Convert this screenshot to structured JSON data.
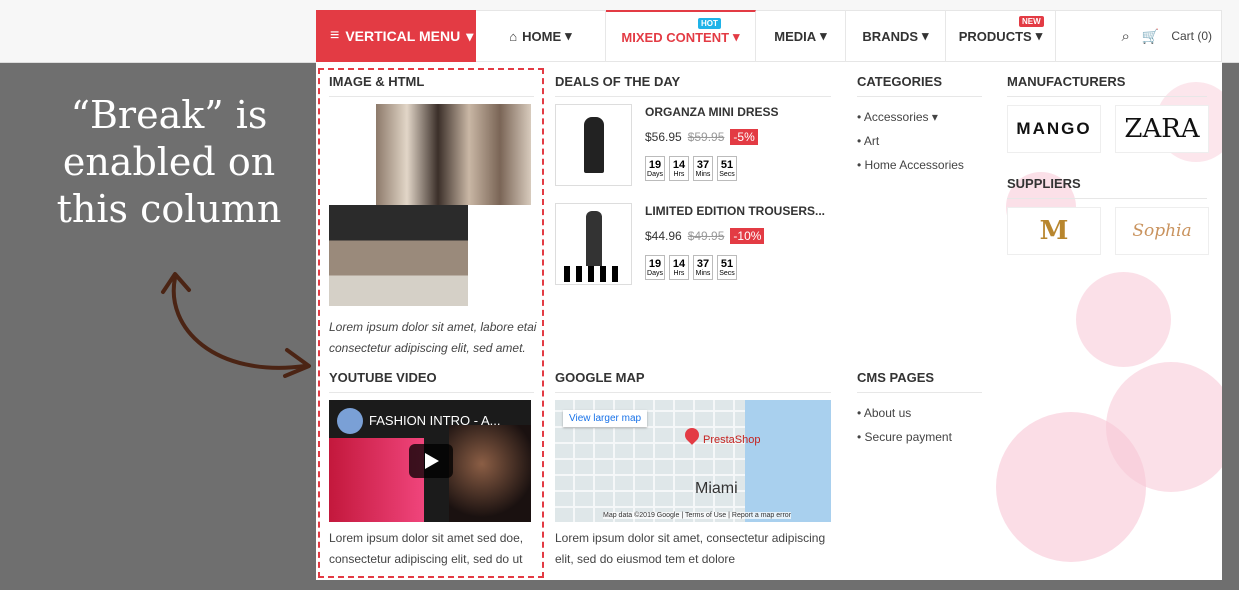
{
  "menu": {
    "vertical_menu": "VERTICAL MENU",
    "nav": [
      {
        "label": "HOME"
      },
      {
        "label": "MIXED CONTENT",
        "badge": "HOT",
        "badge_color": "#1fb3e8"
      },
      {
        "label": "MEDIA"
      },
      {
        "label": "BRANDS"
      },
      {
        "label": "PRODUCTS",
        "badge": "NEW",
        "badge_color": "#e33b44"
      }
    ],
    "cart_label": "Cart (0)"
  },
  "columns": {
    "image_html": {
      "title": "IMAGE & HTML",
      "text_line1": "Lorem ipsum dolor sit amet, labore etai",
      "text_line2": "consectetur adipiscing elit, sed amet."
    },
    "youtube": {
      "title": "YOUTUBE VIDEO",
      "video_title": "FASHION INTRO - A...",
      "text_line1": "Lorem ipsum dolor sit amet sed doe,",
      "text_line2": "consectetur adipiscing elit, sed do ut"
    },
    "deals": {
      "title": "DEALS OF THE DAY",
      "products": [
        {
          "name": "ORGANZA MINI DRESS",
          "price": "$56.95",
          "old_price": "$59.95",
          "discount": "-5%"
        },
        {
          "name": "LIMITED EDITION TROUSERS...",
          "price": "$44.96",
          "old_price": "$49.95",
          "discount": "-10%"
        }
      ],
      "timer": [
        {
          "value": "19",
          "unit": "Days"
        },
        {
          "value": "14",
          "unit": "Hrs"
        },
        {
          "value": "37",
          "unit": "Mins"
        },
        {
          "value": "51",
          "unit": "Secs"
        }
      ]
    },
    "google_map": {
      "title": "GOOGLE MAP",
      "larger_map": "View larger map",
      "place": "PrestaShop",
      "city": "Miami",
      "attribution": "Map data ©2019 Google | Terms of Use | Report a map error",
      "text_line1": "Lorem ipsum dolor sit amet, consectetur adipiscing",
      "text_line2": "elit, sed do eiusmod tem et dolore"
    },
    "categories": {
      "title": "CATEGORIES",
      "items": [
        "• Accessories",
        "• Art",
        "• Home Accessories"
      ]
    },
    "cms": {
      "title": "CMS PAGES",
      "items": [
        "• About us",
        "• Secure payment"
      ]
    },
    "manufacturers": {
      "title": "MANUFACTURERS",
      "logos": [
        "MANGO",
        "ZARA"
      ]
    },
    "suppliers": {
      "title": "SUPPLIERS",
      "logos": [
        "M",
        "Sophia"
      ]
    }
  },
  "callout": {
    "line1": "“Break” is",
    "line2": "enabled on",
    "line3": "this column"
  }
}
